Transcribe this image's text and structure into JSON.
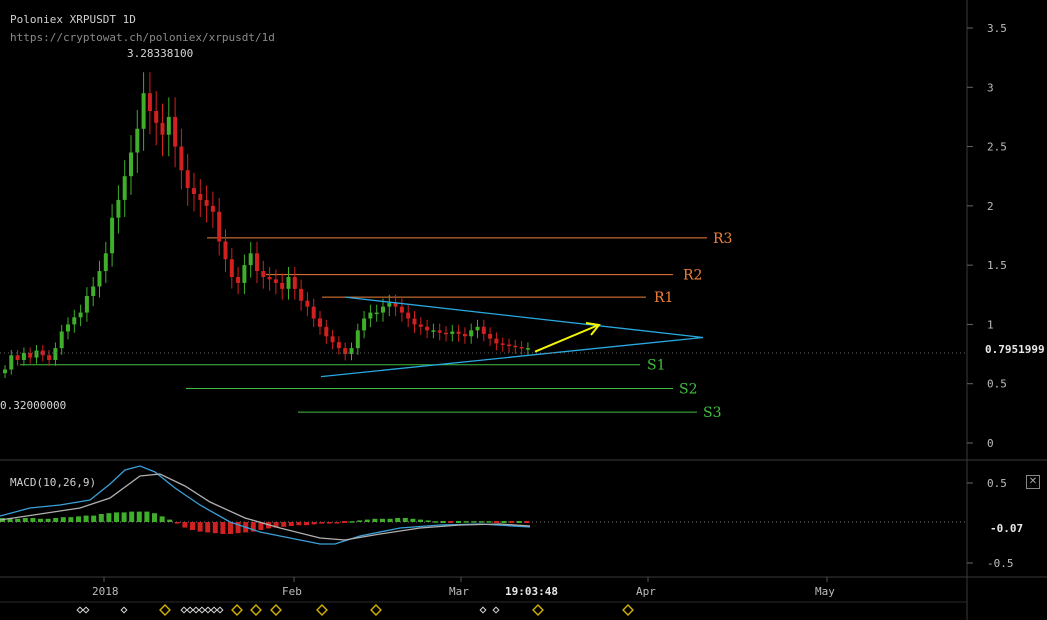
{
  "header": {
    "title": "Poloniex XRPUSDT 1D",
    "url": "https://cryptowat.ch/poloniex/xrpusdt/1d"
  },
  "colors": {
    "up": "#3fae2a",
    "down": "#d12020",
    "trend": "#29a8e0",
    "resistance": "#f0803c",
    "support": "#40c040",
    "arrow": "#f5f500",
    "marker": "#d4b000"
  },
  "price_panel": {
    "y_ticks": [
      "3.5",
      "3",
      "2.5",
      "2",
      "1.5",
      "1",
      "0.5",
      "0"
    ],
    "last_price": "0.7951999",
    "high_label": "3.28338100",
    "low_label": "0.32000000"
  },
  "macd_panel": {
    "label": "MACD(10,26,9)",
    "y_ticks": [
      "0.5",
      "-0.5"
    ],
    "current_value": "-0.07",
    "close_icon": "close-icon"
  },
  "x_axis": {
    "labels": [
      "2018",
      "Feb",
      "Mar",
      "Apr",
      "May"
    ],
    "crosshair_time": "19:03:48"
  },
  "levels": {
    "resistance": [
      {
        "label": "R3",
        "value": 1.73
      },
      {
        "label": "R2",
        "value": 1.42
      },
      {
        "label": "R1",
        "value": 1.23
      }
    ],
    "support": [
      {
        "label": "S1",
        "value": 0.66
      },
      {
        "label": "S2",
        "value": 0.46
      },
      {
        "label": "S3",
        "value": 0.26
      }
    ]
  },
  "chart_data": {
    "type": "candlestick",
    "title": "Poloniex XRPUSDT 1D",
    "ylim": [
      0,
      3.6
    ],
    "xlabels": [
      "2018",
      "Feb",
      "Mar",
      "Apr",
      "May"
    ],
    "series": [
      {
        "name": "XRPUSDT",
        "values": [
          0.62,
          0.74,
          0.7,
          0.76,
          0.72,
          0.78,
          0.74,
          0.7,
          0.8,
          0.94,
          1.0,
          1.06,
          1.1,
          1.24,
          1.32,
          1.45,
          1.6,
          1.9,
          2.05,
          2.25,
          2.45,
          2.65,
          2.95,
          2.8,
          2.7,
          2.6,
          2.75,
          2.5,
          2.3,
          2.15,
          2.1,
          2.05,
          2.0,
          1.95,
          1.7,
          1.55,
          1.4,
          1.35,
          1.5,
          1.6,
          1.45,
          1.4,
          1.38,
          1.35,
          1.3,
          1.4,
          1.3,
          1.2,
          1.15,
          1.05,
          0.98,
          0.9,
          0.85,
          0.8,
          0.75,
          0.8,
          0.95,
          1.05,
          1.1,
          1.1,
          1.15,
          1.18,
          1.15,
          1.1,
          1.05,
          1.0,
          0.98,
          0.95,
          0.95,
          0.93,
          0.92,
          0.94,
          0.92,
          0.9,
          0.95,
          0.98,
          0.92,
          0.88,
          0.84,
          0.83,
          0.82,
          0.81,
          0.8,
          0.8
        ]
      },
      {
        "name": "MACD histogram",
        "values": [
          0.05,
          0.05,
          0.04,
          0.05,
          0.05,
          0.04,
          0.04,
          0.05,
          0.06,
          0.06,
          0.07,
          0.08,
          0.08,
          0.1,
          0.11,
          0.12,
          0.12,
          0.13,
          0.13,
          0.13,
          0.11,
          0.07,
          0.03,
          -0.02,
          -0.07,
          -0.1,
          -0.12,
          -0.13,
          -0.14,
          -0.15,
          -0.15,
          -0.14,
          -0.13,
          -0.12,
          -0.1,
          -0.08,
          -0.07,
          -0.06,
          -0.05,
          -0.04,
          -0.04,
          -0.03,
          -0.02,
          -0.02,
          -0.01,
          0.0,
          0.01,
          0.02,
          0.03,
          0.04,
          0.04,
          0.04,
          0.05,
          0.05,
          0.04,
          0.03,
          0.02,
          0.01,
          0.0,
          0.0,
          0.0,
          0.01,
          0.01,
          0.01,
          0.01,
          0.0,
          0.0,
          0.0,
          0.0,
          0.0
        ]
      }
    ],
    "annotations": [
      "3.28338100",
      "0.32000000",
      "0.7951999",
      "R1",
      "R2",
      "R3",
      "S1",
      "S2",
      "S3"
    ]
  }
}
